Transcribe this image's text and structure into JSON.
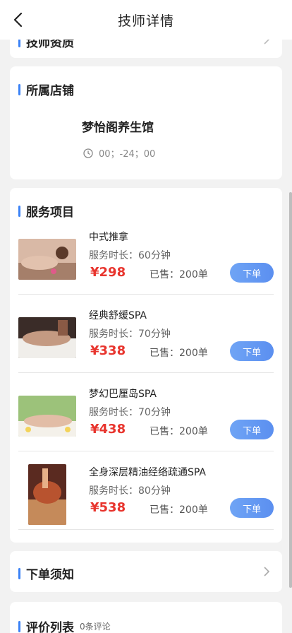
{
  "header": {
    "title": "技师详情"
  },
  "qualification": {
    "title": "技师资质"
  },
  "store": {
    "title": "所属店铺",
    "name": "梦怡阁养生馆",
    "hours": "00；-24；00"
  },
  "services": {
    "title": "服务项目",
    "items": [
      {
        "name": "中式推拿",
        "duration": "服务时长：60分钟",
        "price": "¥298",
        "sold": "已售：200单",
        "button": "下单"
      },
      {
        "name": "经典舒缓SPA",
        "duration": "服务时长：70分钟",
        "price": "¥338",
        "sold": "已售：200单",
        "button": "下单"
      },
      {
        "name": "梦幻巴厘岛SPA",
        "duration": "服务时长：70分钟",
        "price": "¥438",
        "sold": "已售：200单",
        "button": "下单"
      },
      {
        "name": "全身深层精油经络疏通SPA",
        "duration": "服务时长：80分钟",
        "price": "¥538",
        "sold": "已售：200单",
        "button": "下单"
      }
    ]
  },
  "notice": {
    "title": "下单须知"
  },
  "reviews": {
    "title": "评价列表",
    "count": "0条评论"
  },
  "colors": {
    "accent": "#3b82f6",
    "price": "#e8352e",
    "button": "#5b8ff0"
  },
  "icons": [
    "back-icon",
    "chevron-right-icon",
    "clock-icon"
  ]
}
